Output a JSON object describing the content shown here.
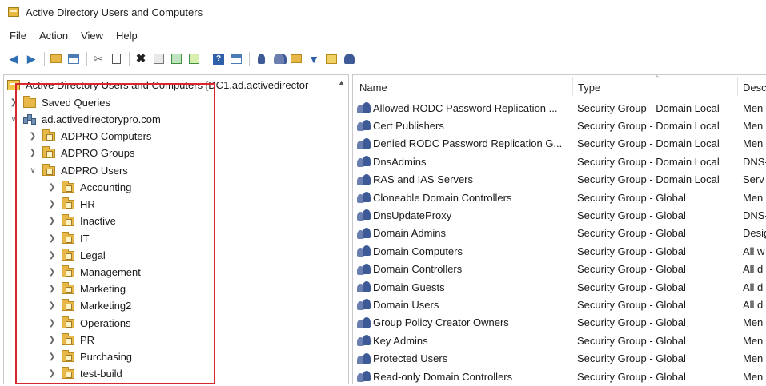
{
  "window": {
    "title": "Active Directory Users and Computers"
  },
  "menu": [
    "File",
    "Action",
    "View",
    "Help"
  ],
  "toolbar": {
    "icons": [
      "back-arrow-icon",
      "forward-arrow-icon",
      "up-folder-icon",
      "show-hide-console-tree-icon",
      "cut-icon",
      "copy-icon",
      "delete-icon",
      "properties-icon",
      "refresh-icon",
      "export-list-icon",
      "help-icon",
      "details-view-icon",
      "new-user-icon",
      "new-group-icon",
      "new-ou-icon",
      "filter-icon",
      "find-icon",
      "add-to-group-icon"
    ]
  },
  "tree": {
    "root_label": "Active Directory Users and Computers [DC1.ad.activedirector",
    "saved_queries": "Saved Queries",
    "domain": "ad.activedirectorypro.com",
    "domain_children": [
      "ADPRO Computers",
      "ADPRO Groups",
      "ADPRO Users"
    ],
    "adpro_users_children": [
      "Accounting",
      "HR",
      "Inactive",
      "IT",
      "Legal",
      "Management",
      "Marketing",
      "Marketing2",
      "Operations",
      "PR",
      "Purchasing",
      "test-build"
    ]
  },
  "list": {
    "columns": {
      "name": "Name",
      "type": "Type",
      "description": "Desc"
    },
    "rows": [
      {
        "name": "Allowed RODC Password Replication ...",
        "type": "Security Group - Domain Local",
        "desc": "Men"
      },
      {
        "name": "Cert Publishers",
        "type": "Security Group - Domain Local",
        "desc": "Men"
      },
      {
        "name": "Denied RODC Password Replication G...",
        "type": "Security Group - Domain Local",
        "desc": "Men"
      },
      {
        "name": "DnsAdmins",
        "type": "Security Group - Domain Local",
        "desc": "DNS-"
      },
      {
        "name": "RAS and IAS Servers",
        "type": "Security Group - Domain Local",
        "desc": "Serv"
      },
      {
        "name": "Cloneable Domain Controllers",
        "type": "Security Group - Global",
        "desc": "Men"
      },
      {
        "name": "DnsUpdateProxy",
        "type": "Security Group - Global",
        "desc": "DNS-"
      },
      {
        "name": "Domain Admins",
        "type": "Security Group - Global",
        "desc": "Desig"
      },
      {
        "name": "Domain Computers",
        "type": "Security Group - Global",
        "desc": "All w"
      },
      {
        "name": "Domain Controllers",
        "type": "Security Group - Global",
        "desc": "All d"
      },
      {
        "name": "Domain Guests",
        "type": "Security Group - Global",
        "desc": "All d"
      },
      {
        "name": "Domain Users",
        "type": "Security Group - Global",
        "desc": "All d"
      },
      {
        "name": "Group Policy Creator Owners",
        "type": "Security Group - Global",
        "desc": "Men"
      },
      {
        "name": "Key Admins",
        "type": "Security Group - Global",
        "desc": "Men"
      },
      {
        "name": "Protected Users",
        "type": "Security Group - Global",
        "desc": "Men"
      },
      {
        "name": "Read-only Domain Controllers",
        "type": "Security Group - Global",
        "desc": "Men"
      }
    ]
  },
  "colors": {
    "highlight": "#d9262c",
    "folder": "#e7b847",
    "group_icon": "#3e5a96"
  }
}
